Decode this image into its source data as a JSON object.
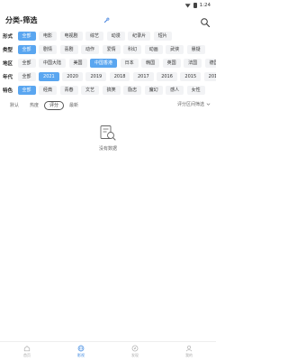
{
  "status": {
    "time": "1:24"
  },
  "header": {
    "title": "分类-筛选"
  },
  "filters": [
    {
      "label": "形式",
      "options": [
        "全部",
        "电影",
        "电视剧",
        "综艺",
        "动漫",
        "纪录片",
        "短片"
      ],
      "active": 0
    },
    {
      "label": "类型",
      "options": [
        "全部",
        "剧情",
        "喜剧",
        "动作",
        "爱情",
        "科幻",
        "动画",
        "武侠",
        "悬疑"
      ],
      "active": 0
    },
    {
      "label": "地区",
      "options": [
        "全部",
        "中国大陆",
        "美国",
        "中国香港",
        "日本",
        "韩国",
        "英国",
        "法国",
        "德国"
      ],
      "active": 3
    },
    {
      "label": "年代",
      "options": [
        "全部",
        "2021",
        "2020",
        "2019",
        "2018",
        "2017",
        "2016",
        "2015",
        "2014"
      ],
      "active": 1
    },
    {
      "label": "特色",
      "options": [
        "全部",
        "经典",
        "青春",
        "文艺",
        "搞笑",
        "励志",
        "魔幻",
        "感人",
        "女性"
      ],
      "active": 0
    }
  ],
  "sort": {
    "options": [
      "默认",
      "热度",
      "评分",
      "最新"
    ],
    "active": 2,
    "range_label": "评分区间筛选"
  },
  "empty": {
    "text": "没有数据"
  },
  "tabbar": {
    "items": [
      {
        "label": "首页",
        "icon": "home-icon"
      },
      {
        "label": "影视",
        "icon": "globe-icon"
      },
      {
        "label": "发现",
        "icon": "compass-icon"
      },
      {
        "label": "我的",
        "icon": "user-icon"
      }
    ],
    "active": 1
  },
  "colors": {
    "accent": "#5aa6f0",
    "chip_bg": "#f2f3f5"
  }
}
